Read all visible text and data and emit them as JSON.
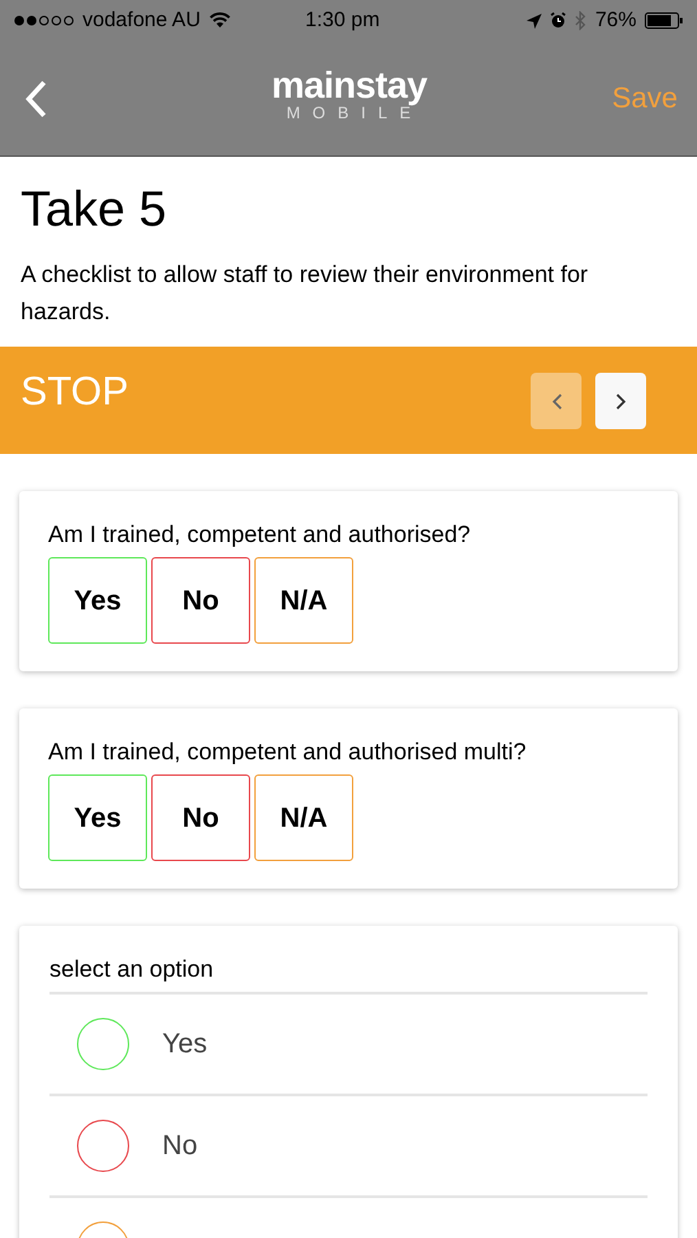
{
  "status_bar": {
    "carrier": "vodafone AU",
    "time": "1:30 pm",
    "battery": "76%"
  },
  "nav_bar": {
    "logo": "mainstay",
    "logo_sub": "MOBILE",
    "action": "Save"
  },
  "page": {
    "title": "Take 5",
    "description": "A checklist to allow staff to review their environment for hazards."
  },
  "section": {
    "title": "STOP",
    "prev_disabled": true,
    "next_disabled": false
  },
  "questions": [
    {
      "kind": "buttons",
      "label": "Am I trained, competent and authorised?",
      "options": [
        {
          "label": "Yes",
          "color": "#5ee85a"
        },
        {
          "label": "No",
          "color": "#e8484d"
        },
        {
          "label": "N/A",
          "color": "#f2a03d"
        }
      ]
    },
    {
      "kind": "buttons",
      "label": "Am I trained, competent and authorised multi?",
      "options": [
        {
          "label": "Yes",
          "color": "#5ee85a"
        },
        {
          "label": "No",
          "color": "#e8484d"
        },
        {
          "label": "N/A",
          "color": "#f2a03d"
        }
      ]
    },
    {
      "kind": "radio",
      "label": "select an option",
      "options": [
        {
          "label": "Yes",
          "color": "#5ee85a"
        },
        {
          "label": "No",
          "color": "#e8484d"
        },
        {
          "color": "#f2a03d"
        }
      ]
    }
  ]
}
